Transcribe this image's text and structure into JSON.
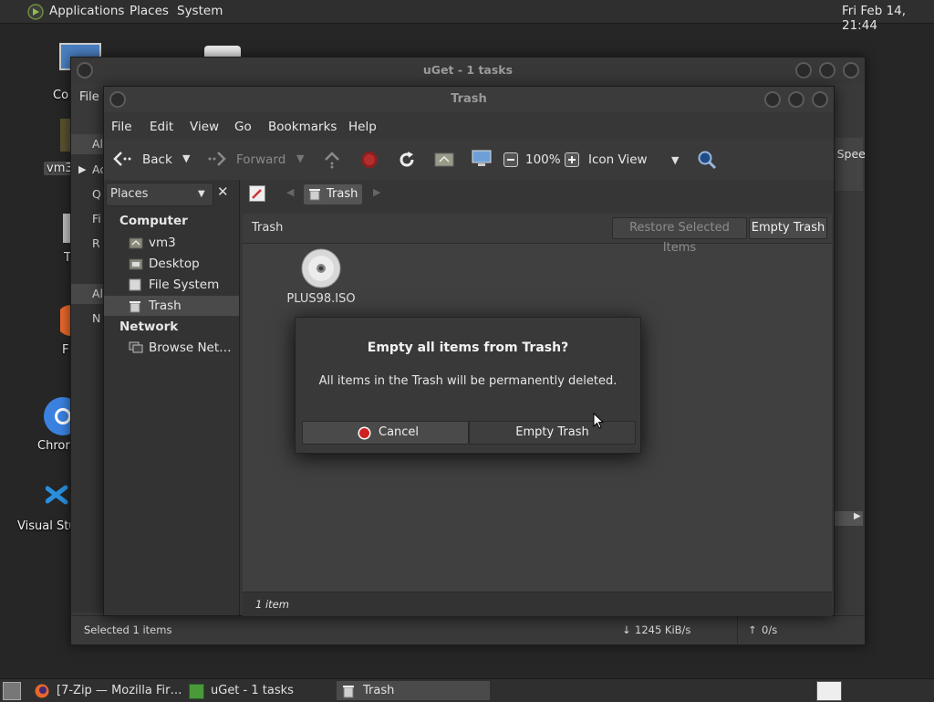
{
  "top_panel": {
    "menus": [
      "Applications",
      "Places",
      "System"
    ],
    "clock": "Fri Feb 14, 21:44"
  },
  "desktop": {
    "icons": [
      {
        "label": "Co",
        "icon": "computer-icon"
      },
      {
        "label": "vm3",
        "icon": "folder-icon"
      },
      {
        "label": "T",
        "icon": "trash-icon"
      },
      {
        "label": "F",
        "icon": "firefox-icon"
      },
      {
        "label": "Chror",
        "icon": "chromium-icon"
      },
      {
        "label": "Visual Stu",
        "icon": "vscode-icon"
      }
    ]
  },
  "uget_window": {
    "title": "uGet - 1 tasks",
    "menu_file": "File",
    "side_fragments": [
      "Al",
      "Ac",
      "Q",
      "Fi",
      "R",
      "Al",
      "N"
    ],
    "speed_fragment": "o Spee",
    "status": {
      "selected": "Selected 1 items",
      "down_speed": "1245 KiB/s",
      "up_speed": "0/s",
      "down_arrow": "↓",
      "up_arrow": "↑"
    }
  },
  "trash_window": {
    "title": "Trash",
    "menu": [
      "File",
      "Edit",
      "View",
      "Go",
      "Bookmarks",
      "Help"
    ],
    "toolbar": {
      "back": "Back",
      "forward": "Forward",
      "zoom": "100%",
      "view_mode": "Icon View"
    },
    "sidebar": {
      "selector": "Places",
      "sections": [
        {
          "heading": "Computer",
          "items": [
            {
              "label": "vm3",
              "icon": "home-folder-icon"
            },
            {
              "label": "Desktop",
              "icon": "desktop-folder-icon"
            },
            {
              "label": "File System",
              "icon": "drive-icon"
            },
            {
              "label": "Trash",
              "icon": "trash-icon"
            }
          ]
        },
        {
          "heading": "Network",
          "items": [
            {
              "label": "Browse Net…",
              "icon": "network-icon"
            }
          ]
        }
      ]
    },
    "path": "Trash",
    "info_label": "Trash",
    "restore_button": "Restore Selected Items",
    "empty_button": "Empty Trash",
    "file": {
      "name": "PLUS98.ISO",
      "icon": "disc-image-icon"
    },
    "status_count": "1 item"
  },
  "dialog": {
    "title": "Empty all items from Trash?",
    "message": "All items in the Trash will be permanently deleted.",
    "cancel": "Cancel",
    "confirm": "Empty Trash"
  },
  "taskbar": {
    "tasks": [
      {
        "label": "[7-Zip — Mozilla Fir…",
        "icon": "firefox-icon"
      },
      {
        "label": "uGet - 1 tasks",
        "icon": "uget-icon"
      },
      {
        "label": "Trash",
        "icon": "trash-icon"
      }
    ]
  }
}
